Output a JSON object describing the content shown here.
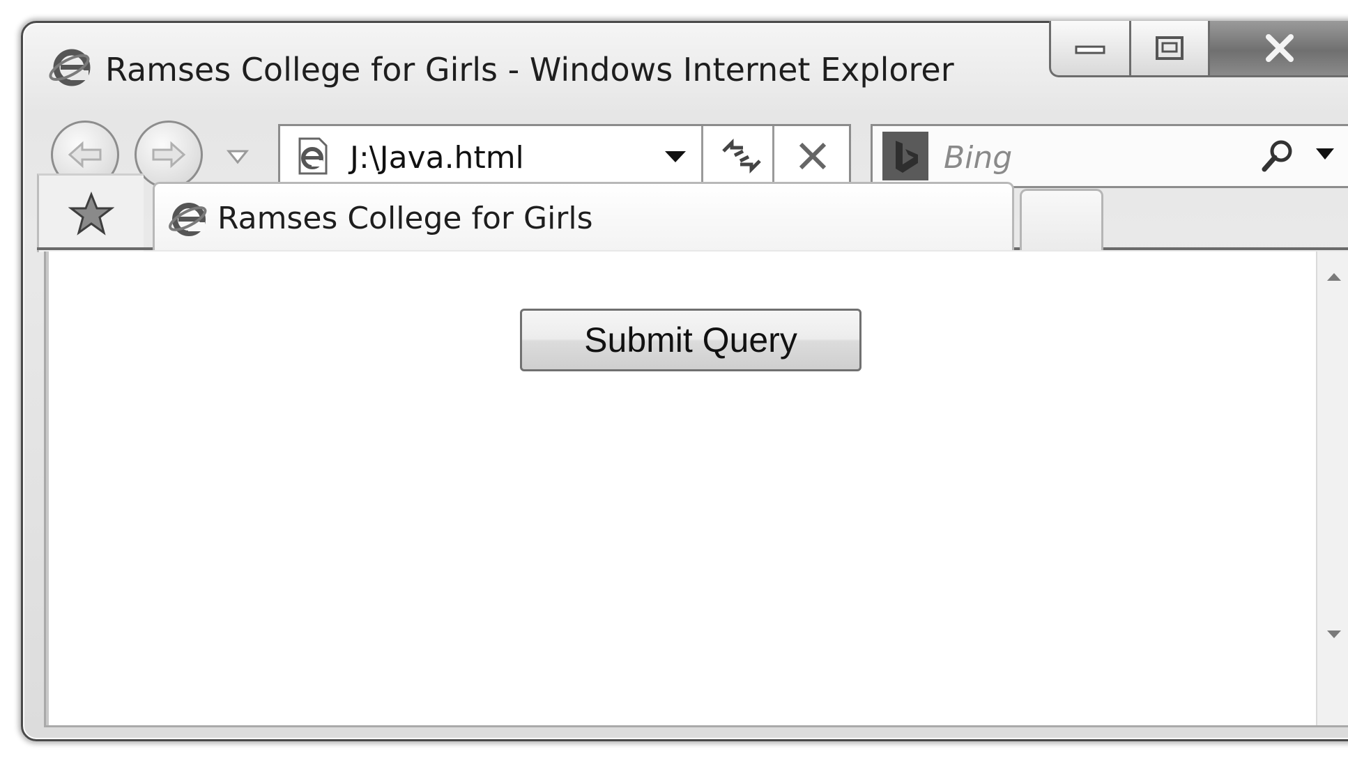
{
  "window": {
    "title": "Ramses College for Girls - Windows Internet Explorer",
    "icon": "internet-explorer-icon"
  },
  "caption_buttons": {
    "minimize_icon": "minimize-icon",
    "maximize_icon": "maximize-icon",
    "close_icon": "close-icon"
  },
  "navigation": {
    "back_icon": "back-arrow-icon",
    "forward_icon": "forward-arrow-icon",
    "recent_pages_icon": "chevron-down-icon"
  },
  "address_bar": {
    "value": "J:\\Java.html",
    "page_icon": "ie-page-icon",
    "dropdown_icon": "dropdown-arrow-icon",
    "refresh_icon": "refresh-icon",
    "stop_icon": "stop-icon"
  },
  "search_box": {
    "placeholder": "Bing",
    "provider_icon": "bing-icon",
    "search_icon": "search-icon",
    "dropdown_icon": "dropdown-arrow-icon"
  },
  "tabs": {
    "favorites_icon": "favorites-star-icon",
    "items": [
      {
        "label": "Ramses College for Girls",
        "icon": "ie-page-icon",
        "active": true
      }
    ],
    "new_tab": ""
  },
  "content": {
    "submit_button": "Submit Query"
  },
  "scrollbar": {
    "up_icon": "scroll-up-icon",
    "down_icon": "scroll-down-icon"
  }
}
